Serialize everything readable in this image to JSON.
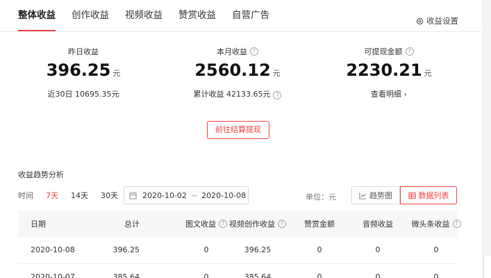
{
  "tabs": [
    "整体收益",
    "创作收益",
    "视频收益",
    "赞赏收益",
    "自营广告"
  ],
  "settings_label": "收益设置",
  "stats": {
    "yesterday": {
      "label": "昨日收益",
      "value": "396.25",
      "unit": "元",
      "sub": "近30日 10695.35元"
    },
    "month": {
      "label": "本月收益",
      "value": "2560.12",
      "unit": "元",
      "sub": "累计收益 42133.65元"
    },
    "withdrawable": {
      "label": "可提现金额",
      "value": "2230.21",
      "unit": "元",
      "sub": "查看明细 ›"
    }
  },
  "cta_label": "前往结算提现",
  "trend": {
    "title": "收益趋势分析",
    "time_label": "时间",
    "ranges": [
      "7天",
      "14天",
      "30天"
    ],
    "date_start": "2020-10-02",
    "date_sep": "~",
    "date_end": "2020-10-08",
    "unit_label": "单位：元",
    "view_chart": "趋势图",
    "view_table": "数据列表"
  },
  "table": {
    "headers": [
      "日期",
      "总计",
      "图文收益",
      "视频创作收益",
      "赞赏金额",
      "音频收益",
      "微头条收益"
    ],
    "rows": [
      [
        "2020-10-08",
        "396.25",
        "0",
        "396.25",
        "0",
        "0",
        "0"
      ],
      [
        "2020-10-07",
        "385.64",
        "0",
        "385.64",
        "0",
        "0",
        "0"
      ]
    ]
  },
  "colors": {
    "accent": "#f04142"
  }
}
